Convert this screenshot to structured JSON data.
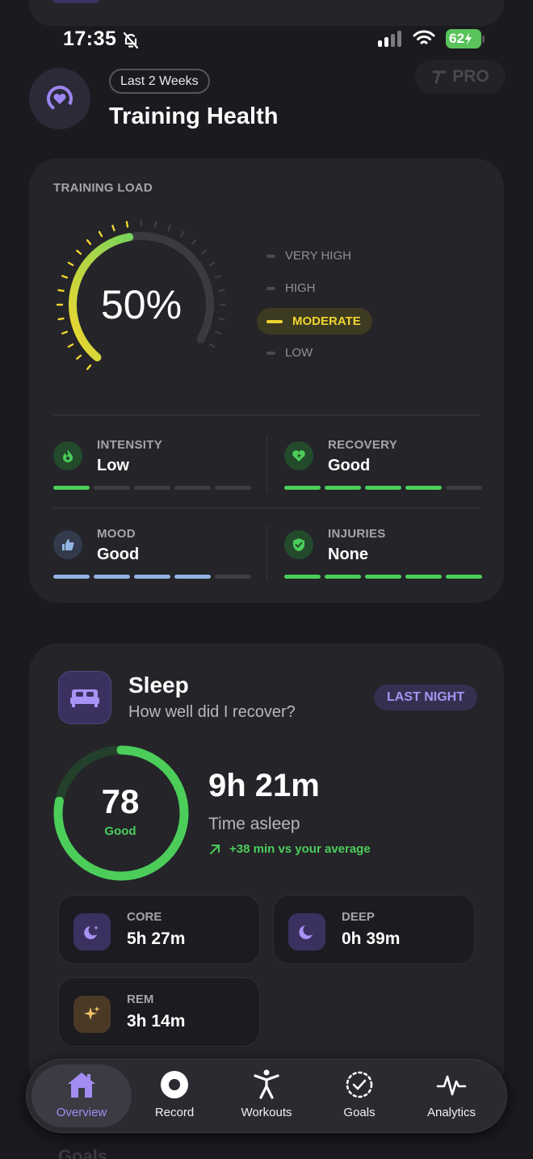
{
  "status_bar": {
    "time": "17:35",
    "battery": "62"
  },
  "header": {
    "period": "Last 2 Weeks",
    "title": "Training Health",
    "pro_label": "PRO"
  },
  "training": {
    "section_label": "TRAINING LOAD",
    "load_percent": 50,
    "load_display": "50%",
    "levels": [
      "VERY HIGH",
      "HIGH",
      "MODERATE",
      "LOW"
    ],
    "active_level": "MODERATE",
    "metrics": [
      {
        "label": "INTENSITY",
        "value": "Low",
        "filled": 1,
        "total": 5,
        "color": "#4ccd5a",
        "icon": "flame-icon"
      },
      {
        "label": "RECOVERY",
        "value": "Good",
        "filled": 4,
        "total": 5,
        "color": "#4ccd5a",
        "icon": "heart-bolt-icon"
      },
      {
        "label": "MOOD",
        "value": "Good",
        "filled": 4,
        "total": 5,
        "color": "#93b4e2",
        "icon": "thumbs-up-icon"
      },
      {
        "label": "INJURIES",
        "value": "None",
        "filled": 5,
        "total": 5,
        "color": "#4ccd5a",
        "icon": "shield-check-icon"
      }
    ]
  },
  "sleep": {
    "title": "Sleep",
    "subtitle": "How well did I recover?",
    "period": "LAST NIGHT",
    "score": "78",
    "score_label": "Good",
    "score_fraction": 0.78,
    "duration": "9h 21m",
    "duration_label": "Time asleep",
    "delta": "+38 min vs your average",
    "stages": [
      {
        "label": "CORE",
        "value": "5h 27m",
        "icon": "moon-stars-icon"
      },
      {
        "label": "DEEP",
        "value": "0h 39m",
        "icon": "moon-icon"
      },
      {
        "label": "REM",
        "value": "3h 14m",
        "icon": "sparkles-icon"
      }
    ]
  },
  "goals_peek": "Goals",
  "tabs": [
    {
      "label": "Overview",
      "icon": "home-icon",
      "active": true
    },
    {
      "label": "Record",
      "icon": "record-icon",
      "active": false
    },
    {
      "label": "Workouts",
      "icon": "person-icon",
      "active": false
    },
    {
      "label": "Goals",
      "icon": "goals-check-icon",
      "active": false
    },
    {
      "label": "Analytics",
      "icon": "pulse-icon",
      "active": false
    }
  ],
  "colors": {
    "accent": "#a28cf2",
    "green": "#4ccd5a",
    "yellow": "#f0d530",
    "card": "#242429",
    "background": "#1a1a1f"
  }
}
